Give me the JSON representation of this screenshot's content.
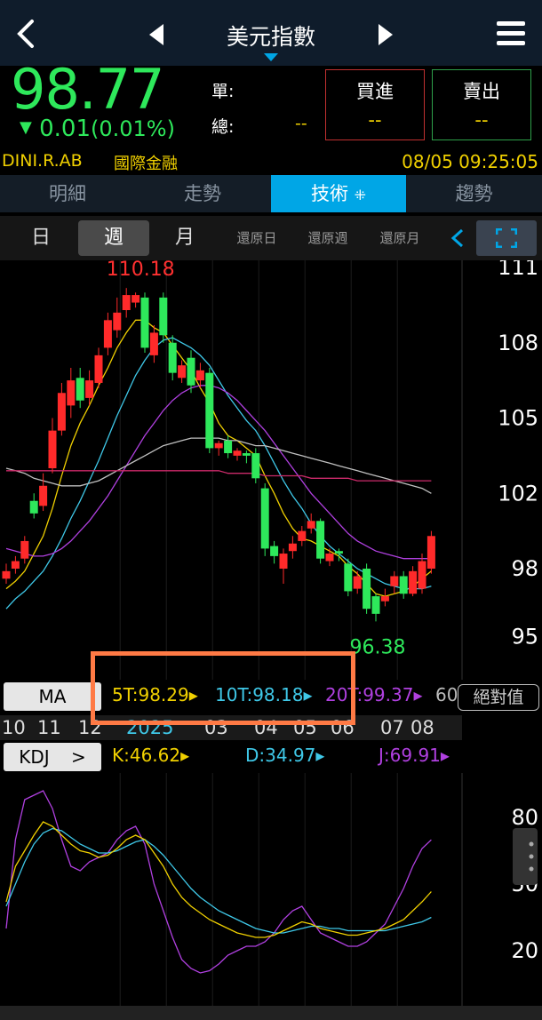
{
  "header": {
    "title": "美元指數"
  },
  "quote": {
    "price": "98.77",
    "change": "0.01",
    "change_pct": "(0.01%)",
    "unit_label": "單:",
    "total_label": "總:",
    "total_value": "--",
    "buy_label": "買進",
    "buy_value": "--",
    "sell_label": "賣出",
    "sell_value": "--",
    "code": "DINI.R.AB",
    "market": "國際金融",
    "datetime": "08/05 09:25:05"
  },
  "tabs": [
    "明細",
    "走勢",
    "技術",
    "趨勢"
  ],
  "periods": [
    "日",
    "週",
    "月",
    "還原日",
    "還原週",
    "還原月"
  ],
  "chart": {
    "y_ticks": [
      "111",
      "108",
      "105",
      "102",
      "98",
      "95"
    ],
    "x_ticks": [
      "10",
      "11",
      "12",
      "2025",
      "03",
      "04",
      "05",
      "06",
      "07",
      "08"
    ],
    "high_label": "110.18",
    "low_label": "96.38"
  },
  "ma_row": {
    "button": "MA",
    "ma5": "5T:98.29",
    "ma10": "10T:98.18",
    "ma20": "20T:99.37",
    "ma60": "60",
    "abs_button": "絕對值"
  },
  "kdj_row": {
    "button": "KDJ",
    "k": "K:46.62",
    "d": "D:34.97",
    "j": "J:69.91",
    "y_ticks": [
      "80",
      "50",
      "20"
    ]
  },
  "colors": {
    "up": "#ff2a2a",
    "down": "#2ee85b",
    "accent": "#00a6e6",
    "ma5": "#f0d000",
    "ma10": "#3fc8e8",
    "ma20": "#b040e0",
    "ma60": "#c0c0c0"
  },
  "chart_data": {
    "type": "candlestick",
    "ylim": [
      95,
      111
    ],
    "candles": [
      {
        "o": 98.6,
        "c": 98.9,
        "h": 99.2,
        "l": 98.4
      },
      {
        "o": 99.0,
        "c": 99.3,
        "h": 99.5,
        "l": 98.8
      },
      {
        "o": 99.4,
        "c": 100.1,
        "h": 100.3,
        "l": 99.2
      },
      {
        "o": 101.7,
        "c": 101.2,
        "h": 102.0,
        "l": 101.0
      },
      {
        "o": 101.5,
        "c": 102.3,
        "h": 102.8,
        "l": 101.3
      },
      {
        "o": 103.0,
        "c": 104.5,
        "h": 105.0,
        "l": 102.8
      },
      {
        "o": 104.5,
        "c": 106.0,
        "h": 106.4,
        "l": 104.3
      },
      {
        "o": 105.5,
        "c": 106.5,
        "h": 107.0,
        "l": 105.0
      },
      {
        "o": 106.6,
        "c": 105.7,
        "h": 107.0,
        "l": 105.4
      },
      {
        "o": 105.8,
        "c": 106.5,
        "h": 106.9,
        "l": 105.5
      },
      {
        "o": 106.4,
        "c": 107.5,
        "h": 107.8,
        "l": 106.2
      },
      {
        "o": 107.8,
        "c": 108.9,
        "h": 109.2,
        "l": 107.5
      },
      {
        "o": 108.5,
        "c": 109.2,
        "h": 109.8,
        "l": 108.2
      },
      {
        "o": 109.3,
        "c": 109.9,
        "h": 110.18,
        "l": 109.0
      },
      {
        "o": 109.6,
        "c": 109.9,
        "h": 110.0,
        "l": 109.4
      },
      {
        "o": 109.8,
        "c": 107.8,
        "h": 110.0,
        "l": 107.6
      },
      {
        "o": 107.5,
        "c": 108.4,
        "h": 108.7,
        "l": 107.2
      },
      {
        "o": 109.8,
        "c": 108.3,
        "h": 110.0,
        "l": 108.0
      },
      {
        "o": 108.0,
        "c": 106.8,
        "h": 108.3,
        "l": 106.5
      },
      {
        "o": 106.6,
        "c": 107.1,
        "h": 107.3,
        "l": 106.4
      },
      {
        "o": 107.4,
        "c": 106.3,
        "h": 107.7,
        "l": 106.0
      },
      {
        "o": 106.5,
        "c": 106.9,
        "h": 107.2,
        "l": 106.2
      },
      {
        "o": 106.8,
        "c": 103.8,
        "h": 107.0,
        "l": 103.6
      },
      {
        "o": 103.8,
        "c": 104.0,
        "h": 104.1,
        "l": 103.5
      },
      {
        "o": 104.1,
        "c": 103.6,
        "h": 104.3,
        "l": 103.4
      },
      {
        "o": 103.5,
        "c": 103.7,
        "h": 103.8,
        "l": 103.3
      },
      {
        "o": 103.6,
        "c": 103.5,
        "h": 103.7,
        "l": 103.2
      },
      {
        "o": 103.6,
        "c": 102.6,
        "h": 103.8,
        "l": 102.4
      },
      {
        "o": 102.2,
        "c": 99.8,
        "h": 102.4,
        "l": 99.5
      },
      {
        "o": 99.9,
        "c": 99.5,
        "h": 100.1,
        "l": 99.2
      },
      {
        "o": 99.0,
        "c": 99.6,
        "h": 99.8,
        "l": 98.4
      },
      {
        "o": 99.7,
        "c": 100.0,
        "h": 100.3,
        "l": 99.4
      },
      {
        "o": 100.1,
        "c": 100.5,
        "h": 100.7,
        "l": 99.9
      },
      {
        "o": 100.6,
        "c": 100.9,
        "h": 101.2,
        "l": 100.4
      },
      {
        "o": 100.9,
        "c": 99.4,
        "h": 101.0,
        "l": 99.2
      },
      {
        "o": 99.3,
        "c": 99.6,
        "h": 99.8,
        "l": 99.1
      },
      {
        "o": 99.7,
        "c": 99.6,
        "h": 99.8,
        "l": 99.3
      },
      {
        "o": 99.2,
        "c": 98.1,
        "h": 99.4,
        "l": 97.9
      },
      {
        "o": 98.2,
        "c": 98.7,
        "h": 98.9,
        "l": 98.0
      },
      {
        "o": 99.0,
        "c": 97.4,
        "h": 99.2,
        "l": 97.2
      },
      {
        "o": 97.9,
        "c": 97.2,
        "h": 98.0,
        "l": 96.9
      },
      {
        "o": 97.7,
        "c": 97.9,
        "h": 98.2,
        "l": 97.5
      },
      {
        "o": 98.3,
        "c": 98.7,
        "h": 98.9,
        "l": 98.0
      },
      {
        "o": 98.7,
        "c": 98.0,
        "h": 98.9,
        "l": 97.8
      },
      {
        "o": 98.0,
        "c": 98.9,
        "h": 99.1,
        "l": 97.9
      },
      {
        "o": 98.2,
        "c": 99.3,
        "h": 99.6,
        "l": 98.0
      },
      {
        "o": 99.0,
        "c": 100.3,
        "h": 100.5,
        "l": 98.8
      }
    ],
    "ma": [
      {
        "name": "5T",
        "color": "#f0d000",
        "values": [
          98.2,
          98.5,
          98.9,
          99.6,
          100.3,
          101.4,
          102.7,
          103.9,
          104.8,
          105.5,
          106.3,
          107.0,
          107.8,
          108.4,
          108.9,
          108.9,
          108.6,
          108.4,
          107.9,
          107.4,
          106.9,
          106.2,
          105.6,
          104.8,
          104.3,
          104.1,
          103.8,
          103.5,
          102.7,
          102.0,
          101.2,
          100.6,
          100.2,
          100.1,
          99.9,
          99.7,
          99.5,
          99.1,
          98.8,
          98.4,
          98.0,
          97.9,
          98.0,
          98.1,
          98.3,
          98.6,
          98.9
        ]
      },
      {
        "name": "10T",
        "color": "#3fc8e8",
        "values": [
          97.4,
          97.8,
          98.1,
          98.5,
          98.9,
          99.5,
          100.2,
          101.0,
          101.7,
          102.5,
          103.3,
          104.2,
          105.1,
          105.9,
          106.7,
          107.3,
          107.8,
          108.1,
          108.2,
          108.0,
          107.8,
          107.5,
          107.1,
          106.5,
          105.9,
          105.4,
          104.9,
          104.5,
          103.9,
          103.2,
          102.5,
          101.9,
          101.4,
          100.8,
          100.3,
          99.9,
          99.6,
          99.3,
          99.0,
          98.8,
          98.6,
          98.4,
          98.3,
          98.2,
          98.2,
          98.2,
          98.3
        ]
      },
      {
        "name": "20T",
        "color": "#b040e0",
        "values": [
          99.8,
          99.7,
          99.6,
          99.5,
          99.5,
          99.6,
          99.8,
          100.1,
          100.5,
          100.9,
          101.4,
          101.9,
          102.5,
          103.1,
          103.7,
          104.3,
          104.8,
          105.3,
          105.7,
          106.0,
          106.2,
          106.3,
          106.3,
          106.2,
          106.0,
          105.7,
          105.3,
          104.9,
          104.5,
          104.0,
          103.5,
          103.0,
          102.5,
          102.0,
          101.6,
          101.2,
          100.8,
          100.4,
          100.1,
          99.9,
          99.7,
          99.6,
          99.5,
          99.4,
          99.4,
          99.4,
          99.4
        ]
      },
      {
        "name": "60T",
        "color": "#c0c0c0",
        "values": [
          103.0,
          102.9,
          102.8,
          102.6,
          102.5,
          102.4,
          102.3,
          102.3,
          102.3,
          102.4,
          102.5,
          102.7,
          102.9,
          103.1,
          103.3,
          103.5,
          103.7,
          103.9,
          104.0,
          104.1,
          104.2,
          104.2,
          104.2,
          104.2,
          104.1,
          104.1,
          104.0,
          103.9,
          103.9,
          103.8,
          103.7,
          103.6,
          103.5,
          103.4,
          103.3,
          103.2,
          103.1,
          103.0,
          102.9,
          102.8,
          102.7,
          102.6,
          102.5,
          102.4,
          102.3,
          102.2,
          102.0
        ]
      },
      {
        "name": "long",
        "color": "#cc2a6a",
        "values": [
          102.9,
          102.9,
          102.9,
          102.9,
          102.9,
          102.9,
          102.9,
          102.9,
          102.9,
          102.9,
          102.9,
          102.9,
          102.9,
          102.9,
          102.9,
          102.9,
          102.9,
          102.9,
          102.9,
          102.9,
          102.9,
          102.9,
          102.9,
          102.9,
          102.8,
          102.8,
          102.8,
          102.8,
          102.7,
          102.7,
          102.7,
          102.7,
          102.7,
          102.6,
          102.6,
          102.6,
          102.6,
          102.6,
          102.5,
          102.5,
          102.5,
          102.5,
          102.5,
          102.5,
          102.5,
          102.5,
          102.5
        ]
      }
    ],
    "kdj": {
      "ylim": [
        0,
        100
      ],
      "K": [
        42,
        58,
        65,
        72,
        78,
        76,
        72,
        68,
        65,
        64,
        62,
        63,
        66,
        70,
        72,
        70,
        64,
        58,
        50,
        44,
        40,
        37,
        34,
        32,
        30,
        28,
        27,
        26,
        26,
        27,
        29,
        31,
        33,
        32,
        30,
        29,
        28,
        27,
        27,
        28,
        29,
        30,
        32,
        34,
        38,
        42,
        46.6
      ],
      "D": [
        40,
        50,
        60,
        68,
        73,
        75,
        74,
        71,
        68,
        66,
        64,
        64,
        65,
        67,
        69,
        70,
        67,
        63,
        58,
        53,
        48,
        44,
        41,
        38,
        36,
        34,
        32,
        30,
        29,
        28,
        28,
        29,
        30,
        31,
        31,
        30,
        30,
        29,
        29,
        29,
        29,
        29,
        30,
        31,
        32,
        33,
        35.0
      ],
      "J": [
        30,
        70,
        88,
        90,
        92,
        84,
        70,
        58,
        56,
        60,
        62,
        64,
        70,
        74,
        76,
        68,
        50,
        38,
        26,
        16,
        12,
        10,
        11,
        14,
        18,
        20,
        22,
        22,
        24,
        28,
        34,
        38,
        40,
        34,
        28,
        26,
        24,
        22,
        22,
        24,
        28,
        32,
        40,
        48,
        58,
        66,
        69.9
      ]
    }
  }
}
